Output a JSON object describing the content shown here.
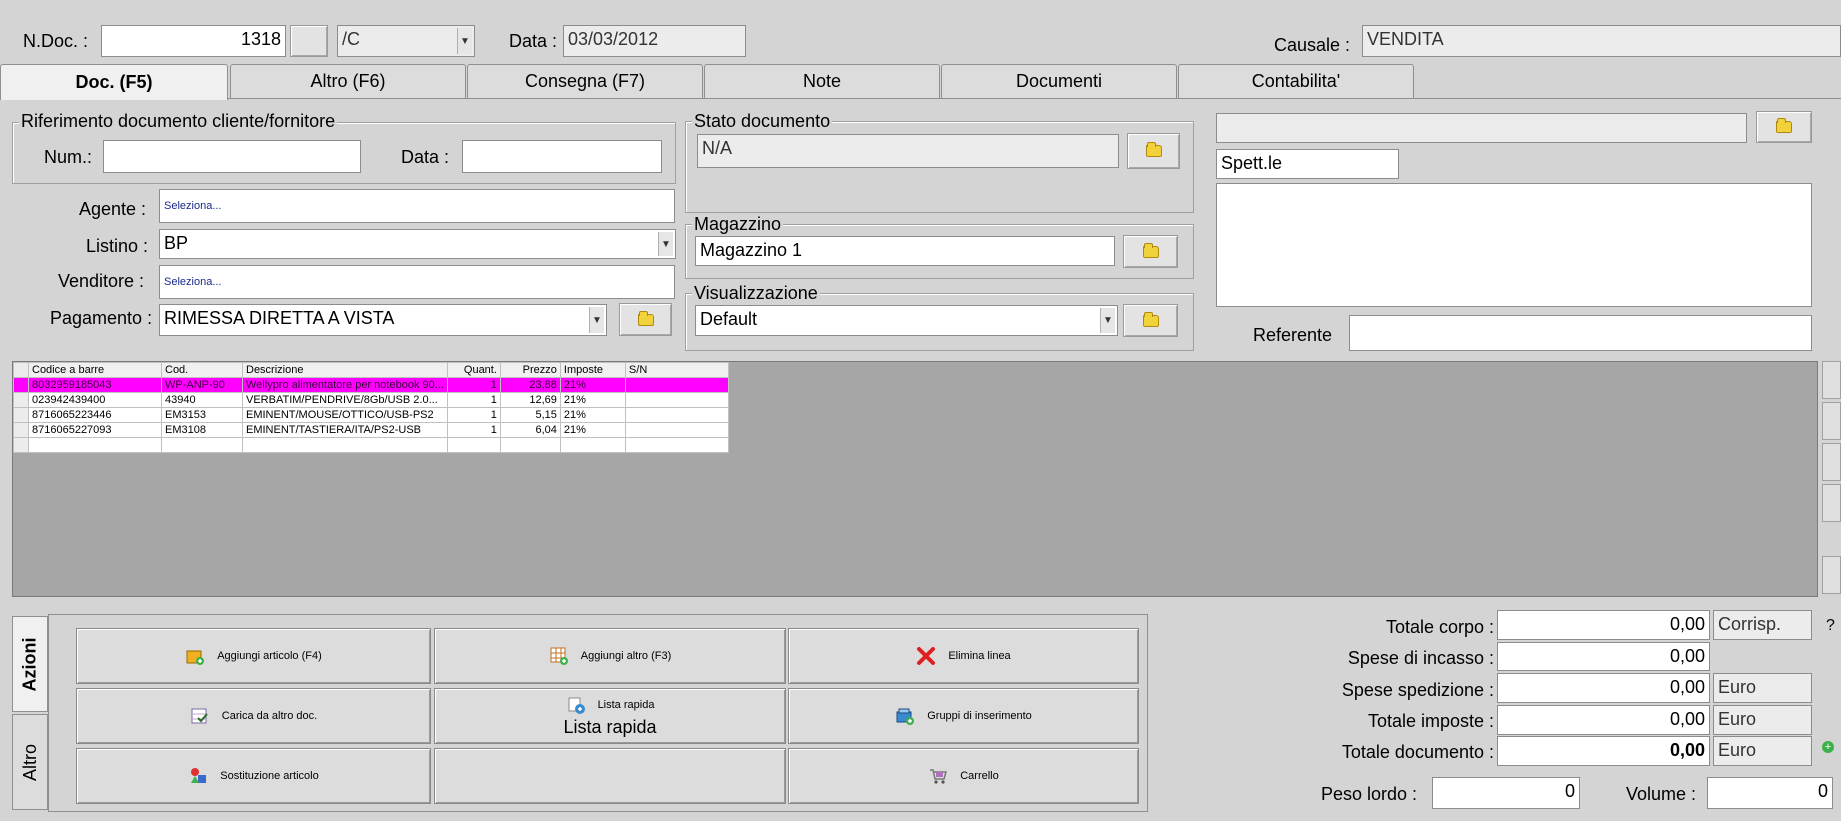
{
  "header": {
    "ndoc_label": "N.Doc. :",
    "ndoc_value": "1318",
    "series_value": "/C",
    "data_label": "Data :",
    "data_value": "03/03/2012",
    "causale_label": "Causale :",
    "causale_value": "VENDITA"
  },
  "tabs": [
    "Doc. (F5)",
    "Altro (F6)",
    "Consegna (F7)",
    "Note",
    "Documenti",
    "Contabilita'"
  ],
  "rif": {
    "legend": "Riferimento documento cliente/fornitore",
    "num_label": "Num.:",
    "num_value": "",
    "data_label": "Data :",
    "data_value": ""
  },
  "agente": {
    "label": "Agente :",
    "value": "Seleziona..."
  },
  "listino": {
    "label": "Listino :",
    "value": "BP"
  },
  "venditore": {
    "label": "Venditore :",
    "value": "Seleziona..."
  },
  "pagamento": {
    "label": "Pagamento :",
    "value": "RIMESSA DIRETTA  A VISTA"
  },
  "stato": {
    "legend": "Stato documento",
    "value": "N/A"
  },
  "magazzino": {
    "legend": "Magazzino",
    "value": "Magazzino 1"
  },
  "visualizzazione": {
    "legend": "Visualizzazione",
    "value": "Default"
  },
  "cliente": {
    "top_value": "",
    "spett_value": "Spett.le",
    "address_value": "",
    "referente_label": "Referente",
    "referente_value": ""
  },
  "grid": {
    "columns": [
      "Codice a barre",
      "Cod.",
      "Descrizione",
      "Quant.",
      "Prezzo",
      "Imposte",
      "S/N"
    ],
    "rows": [
      [
        "8032959185043",
        "WP-ANP-90",
        "Wellypro alimentatore per notebook 90...",
        "1",
        "23,88",
        "21%",
        ""
      ],
      [
        "023942439400",
        "43940",
        "VERBATIM/PENDRIVE/8Gb/USB 2.0...",
        "1",
        "12,69",
        "21%",
        ""
      ],
      [
        "8716065223446",
        "EM3153",
        "EMINENT/MOUSE/OTTICO/USB-PS2",
        "1",
        "5,15",
        "21%",
        ""
      ],
      [
        "8716065227093",
        "EM3108",
        "EMINENT/TASTIERA/ITA/PS2-USB",
        "1",
        "6,04",
        "21%",
        ""
      ]
    ],
    "selected_row": 0
  },
  "side_tabs": [
    "Azioni",
    "Altro"
  ],
  "actions": {
    "aggiungi_articolo": "Aggiungi articolo (F4)",
    "aggiungi_altro": "Aggiungi altro (F3)",
    "elimina_linea": "Elimina linea",
    "carica_altro_doc": "Carica da altro doc.",
    "lista_rapida_small": "Lista rapida",
    "lista_rapida_big": "Lista rapida",
    "gruppi_inserimento": "Gruppi di inserimento",
    "sostituzione_articolo": "Sostituzione articolo",
    "carrello": "Carrello"
  },
  "totals": {
    "totale_corpo_label": "Totale corpo :",
    "totale_corpo_value": "0,00",
    "corrisp": "Corrisp.",
    "spese_incasso_label": "Spese di incasso :",
    "spese_incasso_value": "0,00",
    "spese_spedizione_label": "Spese spedizione :",
    "spese_spedizione_value": "0,00",
    "totale_imposte_label": "Totale imposte :",
    "totale_imposte_value": "0,00",
    "totale_documento_label": "Totale documento :",
    "totale_documento_value": "0,00",
    "currency": "Euro",
    "peso_label": "Peso lordo :",
    "peso_value": "0",
    "volume_label": "Volume :",
    "volume_value": "0",
    "help_glyph": "?"
  }
}
